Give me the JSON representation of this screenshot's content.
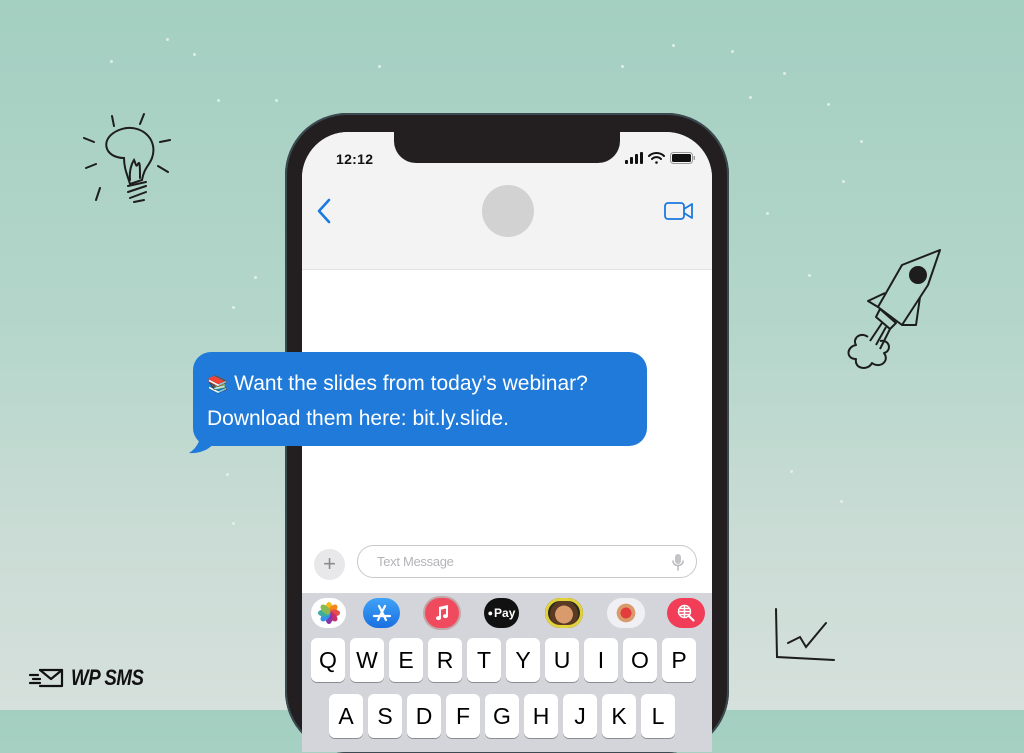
{
  "background": {
    "top_color": "#a3cfc1",
    "bottom_color": "#d6e0dc"
  },
  "phone": {
    "status_bar": {
      "time": "12:12",
      "icons": [
        "signal-icon",
        "wifi-icon",
        "battery-icon"
      ]
    },
    "header": {
      "back_icon": "chevron-left-icon",
      "contact_avatar": "avatar-placeholder",
      "video_icon": "video-camera-icon",
      "accent": "#1a7ae0"
    },
    "composer": {
      "plus_label": "+",
      "placeholder": "Text Message",
      "mic_icon": "microphone-icon"
    },
    "app_tray": [
      {
        "name": "photos"
      },
      {
        "name": "app-store"
      },
      {
        "name": "music"
      },
      {
        "name": "apple-pay",
        "label": "Pay"
      },
      {
        "name": "memoji"
      },
      {
        "name": "animoji-stickers"
      },
      {
        "name": "web-search"
      }
    ],
    "keyboard": {
      "row1": [
        "Q",
        "W",
        "E",
        "R",
        "T",
        "Y",
        "U",
        "I",
        "O",
        "P"
      ],
      "row2": [
        "A",
        "S",
        "D",
        "F",
        "G",
        "H",
        "J",
        "K",
        "L"
      ]
    }
  },
  "message": {
    "emoji": "📚",
    "line1": "Want the slides from today’s webinar?",
    "line2": "Download them here: bit.ly.slide.",
    "bubble_color": "#1f7ad9"
  },
  "brand": {
    "name": "WP SMS",
    "icon": "fast-mail-icon"
  },
  "doodles": [
    "lightbulb-icon",
    "rocket-icon",
    "chart-growth-icon"
  ]
}
